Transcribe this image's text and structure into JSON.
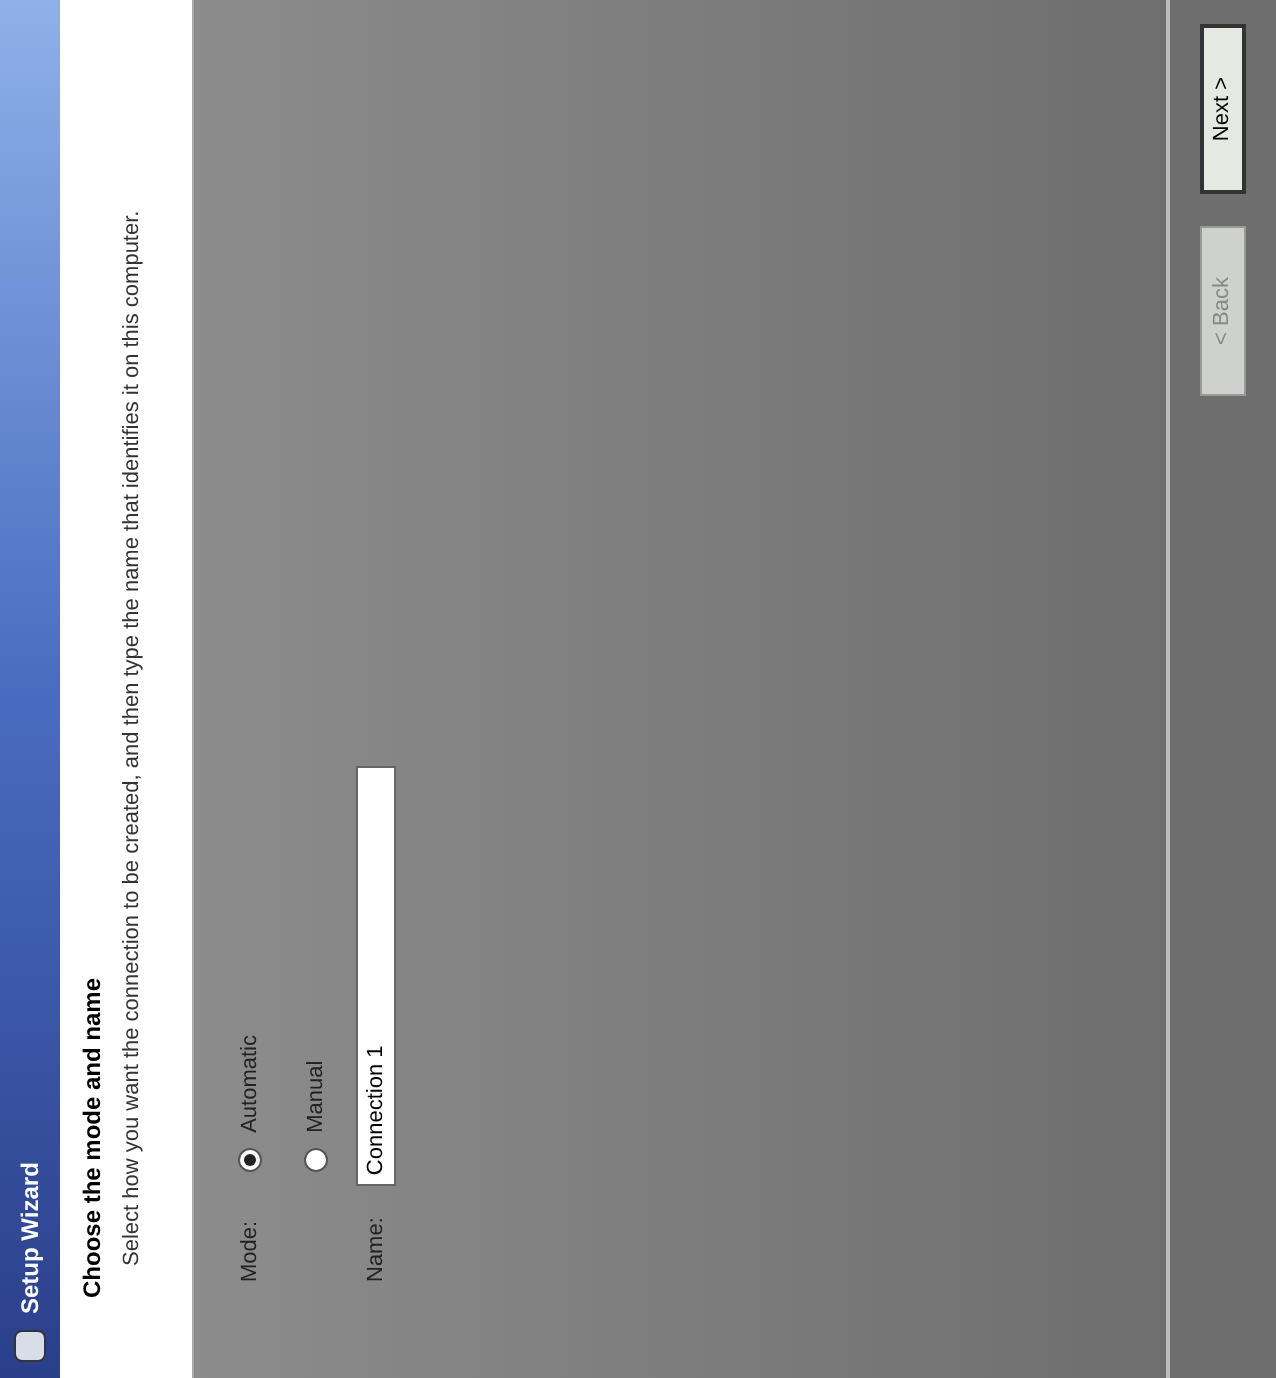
{
  "window": {
    "title": "Setup Wizard"
  },
  "header": {
    "title": "Choose the mode and name",
    "description": "Select how you want the connection to be created, and then type the name that identifies it on this computer."
  },
  "mode": {
    "label": "Mode:",
    "options": [
      {
        "label": "Automatic",
        "selected": true
      },
      {
        "label": "Manual",
        "selected": false
      }
    ]
  },
  "name": {
    "label": "Name:",
    "value": "Connection 1"
  },
  "buttons": [
    {
      "label": "< Back",
      "disabled": true
    },
    {
      "label": "Next >",
      "disabled": false
    }
  ]
}
